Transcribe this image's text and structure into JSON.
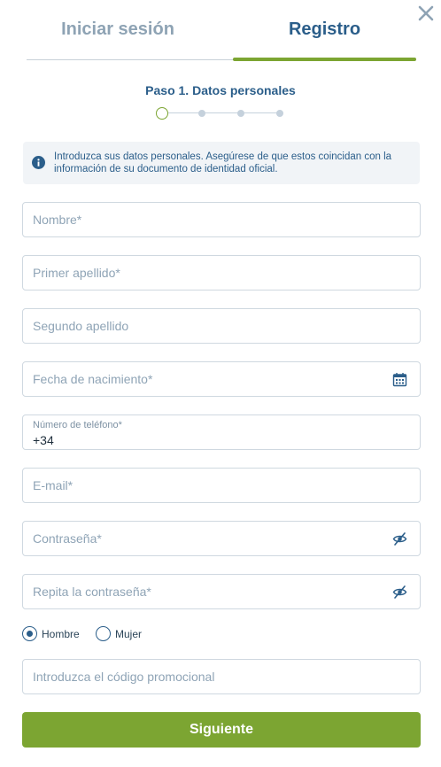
{
  "tabs": {
    "login": "Iniciar sesión",
    "register": "Registro"
  },
  "step": {
    "title": "Paso 1. Datos personales",
    "current": 1,
    "total": 4
  },
  "info": {
    "text": "Introduzca sus datos personales. Asegúrese de que estos coincidan con la información de su documento de identidad oficial."
  },
  "form": {
    "first_name": {
      "placeholder": "Nombre*"
    },
    "last_name": {
      "placeholder": "Primer apellido*"
    },
    "second_last_name": {
      "placeholder": "Segundo apellido"
    },
    "birth_date": {
      "placeholder": "Fecha de nacimiento*",
      "icon": "calendar-icon"
    },
    "phone": {
      "label": "Número de teléfono*",
      "value": "+34"
    },
    "email": {
      "placeholder": "E-mail*"
    },
    "password": {
      "placeholder": "Contraseña*",
      "icon": "eye-slash-icon"
    },
    "password_repeat": {
      "placeholder": "Repita la contraseña*",
      "icon": "eye-slash-icon"
    },
    "gender": {
      "options": [
        "Hombre",
        "Mujer"
      ],
      "selected": "Hombre"
    },
    "promo": {
      "placeholder": "Introduzca el código promocional"
    }
  },
  "submit": {
    "label": "Siguiente"
  },
  "colors": {
    "accent": "#7ca532",
    "primary": "#2b5e8a",
    "muted": "#8ea3b4"
  }
}
